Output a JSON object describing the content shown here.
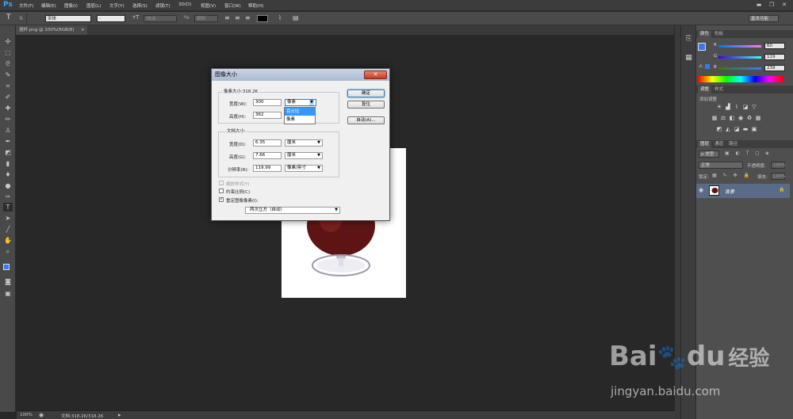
{
  "app": {
    "logo": "Ps"
  },
  "menu": [
    "文件(F)",
    "编辑(E)",
    "图像(I)",
    "图层(L)",
    "文字(Y)",
    "选择(S)",
    "滤镜(T)",
    "3D(D)",
    "视图(V)",
    "窗口(W)",
    "帮助(H)"
  ],
  "window_controls": {
    "minimize": "▬",
    "restore": "❐",
    "close": "✕"
  },
  "options_bar": {
    "tool_icon": "T",
    "font_family": "宋体",
    "font_style": "-",
    "font_size": "36点",
    "antialias": "锐利",
    "workspace": "基本功能"
  },
  "document_tab": {
    "title": "酒杯.png @ 100%(RGB/8)",
    "close": "×"
  },
  "status_bar": {
    "zoom": "100%",
    "doc_info": "文档:318.2K/318.2K",
    "arrow": "▸"
  },
  "color_panel": {
    "tabs": [
      "颜色",
      "色板"
    ],
    "r_label": "R",
    "r_value": "60",
    "g_label": "G",
    "g_value": "119",
    "b_label": "B",
    "b_value": "239",
    "foreground_color": "#3c77ef"
  },
  "adjust_panel": {
    "tabs": [
      "调整",
      "样式"
    ],
    "hint": "添加调整"
  },
  "layers_panel": {
    "tabs": [
      "图层",
      "通道",
      "路径"
    ],
    "filter_label": "ρ 类型",
    "blend_mode": "正常",
    "opacity_label": "不透明度:",
    "opacity_value": "100%",
    "lock_label": "锁定:",
    "fill_label": "填充:",
    "fill_value": "100%",
    "layer_name": "背景"
  },
  "dialog": {
    "title": "图像大小",
    "close": "✕",
    "pixel_dimensions": "像素大小:318.2K",
    "width_label": "宽度(W):",
    "width_value": "300",
    "width_unit": "像素",
    "height_label": "高度(H):",
    "height_value": "362",
    "dropdown_options": [
      "百分比",
      "像素"
    ],
    "doc_size_label": "文档大小:",
    "doc_width_label": "宽度(D):",
    "doc_width_value": "6.35",
    "doc_width_unit": "厘米",
    "doc_height_label": "高度(G):",
    "doc_height_value": "7.66",
    "doc_height_unit": "厘米",
    "resolution_label": "分辨率(R):",
    "resolution_value": "119.99",
    "resolution_unit": "像素/英寸",
    "scale_styles": "缩放样式(Y)",
    "constrain": "约束比例(C)",
    "resample": "重定图像像素(I):",
    "resample_method": "两次立方（自动）",
    "ok": "确定",
    "reset": "复位",
    "auto": "自动(A)..."
  },
  "watermark": {
    "brand": "Bai",
    "brand2": "du",
    "cn": "经验",
    "url": "jingyan.baidu.com"
  }
}
